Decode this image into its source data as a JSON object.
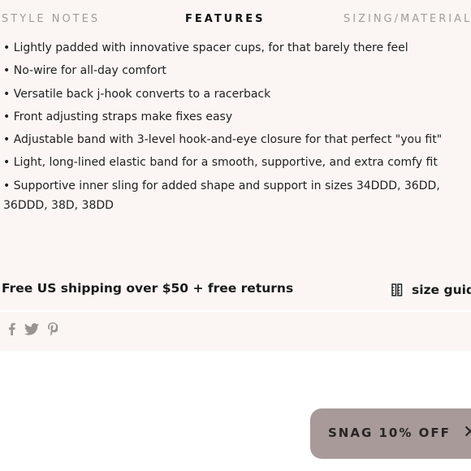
{
  "tabs": [
    {
      "label": "STYLE NOTES",
      "active": false
    },
    {
      "label": "FEATURES",
      "active": true
    },
    {
      "label": "SIZING/MATERIALS",
      "active": false
    }
  ],
  "features": [
    "Lightly padded with innovative spacer cups, for that barely there feel",
    "No-wire for all-day comfort",
    "Versatile back j-hook converts to a racerback",
    "Front adjusting straps make fixes easy",
    "Adjustable band with 3-level hook-and-eye closure for that perfect \"you fit\"",
    "Light, long-lined elastic band for a smooth, supportive, and extra comfy fit",
    "Supportive inner sling for added shape and support in sizes 34DDD, 36DD, 36DDD, 38D, 38DD"
  ],
  "shipping_text": "Free US shipping over $50 + free returns",
  "size_guide": {
    "label": "size guide",
    "icon": "ruler-icon"
  },
  "social": {
    "icons": [
      "facebook-icon",
      "twitter-icon",
      "pinterest-icon"
    ]
  },
  "promo": {
    "label": "SNAG 10% OFF",
    "close_glyph": "✕"
  },
  "colors": {
    "panel_bg": "#fbf6f4",
    "tab_inactive": "#a39c99",
    "promo_bg": "#a79a98",
    "social_icon": "#9a9390"
  }
}
